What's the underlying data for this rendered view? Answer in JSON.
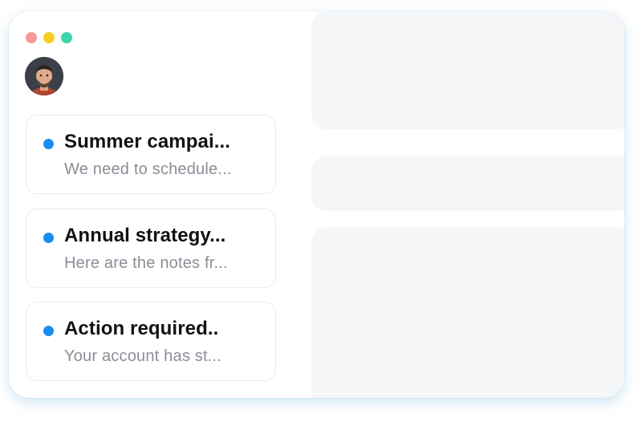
{
  "window": {
    "traffic_lights": [
      {
        "name": "close",
        "color": "#f79a9a"
      },
      {
        "name": "minimize",
        "color": "#f7cf27"
      },
      {
        "name": "maximize",
        "color": "#3fd3b0"
      }
    ]
  },
  "user": {
    "avatar": "user-avatar"
  },
  "messages": [
    {
      "title": "Summer campai...",
      "preview": "We need to schedule...",
      "unread": true
    },
    {
      "title": "Annual strategy...",
      "preview": "Here are the notes fr...",
      "unread": true
    },
    {
      "title": "Action required..",
      "preview": "Your account has st...",
      "unread": true
    }
  ],
  "colors": {
    "unread_dot": "#1a8cf0",
    "skeleton": "#f5f6f8",
    "title_text": "#111111",
    "preview_text": "#8a8e97"
  }
}
